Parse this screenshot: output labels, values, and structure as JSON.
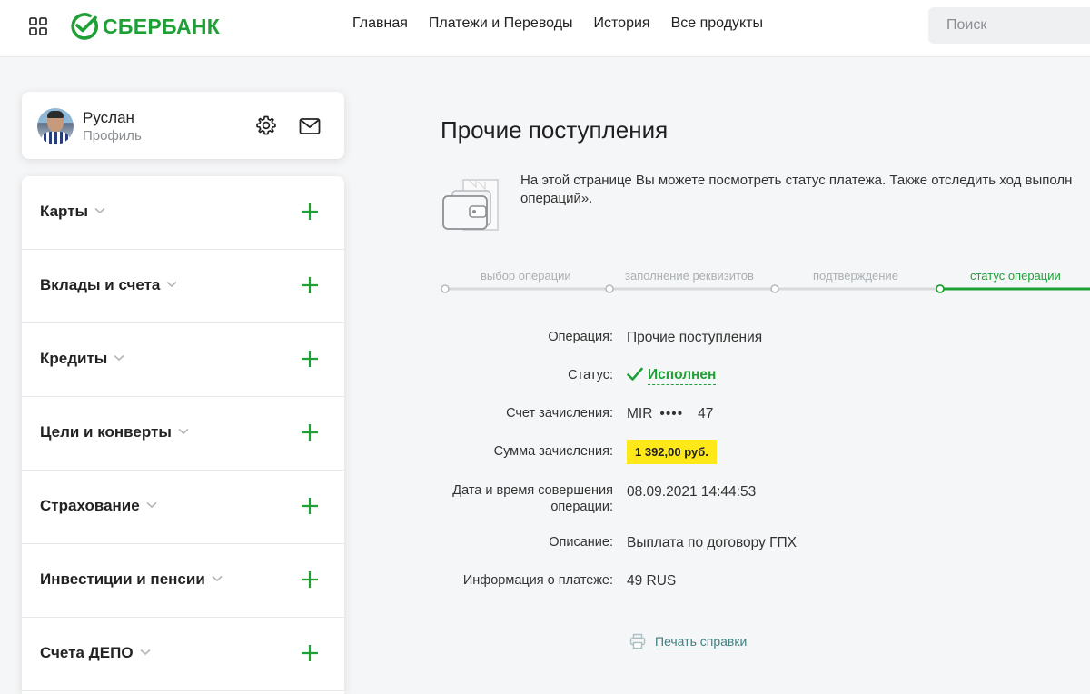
{
  "header": {
    "brand": "СБЕРБАНК",
    "nav": [
      "Главная",
      "Платежи и Переводы",
      "История",
      "Все продукты"
    ],
    "search_placeholder": "Поиск"
  },
  "profile": {
    "name": "Руслан",
    "subtitle": "Профиль"
  },
  "sidebar": {
    "items": [
      {
        "label": "Карты"
      },
      {
        "label": "Вклады и счета"
      },
      {
        "label": "Кредиты"
      },
      {
        "label": "Цели и конверты"
      },
      {
        "label": "Страхование"
      },
      {
        "label": "Инвестиции и пенсии"
      },
      {
        "label": "Счета ДЕПО"
      }
    ]
  },
  "main": {
    "title": "Прочие поступления",
    "info_line1": "На этой странице Вы можете посмотреть статус платежа. Также отследить ход выполн",
    "info_line2": "операций».",
    "steps": [
      "выбор операции",
      "заполнение реквизитов",
      "подтверждение",
      "статус операции"
    ],
    "active_step": 4,
    "details": {
      "operation_label": "Операция:",
      "operation_value": "Прочие поступления",
      "status_label": "Статус:",
      "status_value": "Исполнен",
      "account_label": "Счет зачисления:",
      "account_type": "MIR",
      "account_mask": "••••",
      "account_last": "47",
      "amount_label": "Сумма зачисления:",
      "amount_value": "1 392,00 руб.",
      "datetime_label_1": "Дата и время совершения",
      "datetime_label_2": "операции:",
      "datetime_value": "08.09.2021 14:44:53",
      "description_label": "Описание:",
      "description_value": "Выплата по договору ГПХ",
      "payment_info_label": "Информация о платеже:",
      "payment_info_value": "49 RUS"
    },
    "print_label": "Печать справки"
  },
  "colors": {
    "brand_green": "#1fa037",
    "highlight_yellow": "#ffe81a",
    "link_teal": "#3f7f83"
  }
}
